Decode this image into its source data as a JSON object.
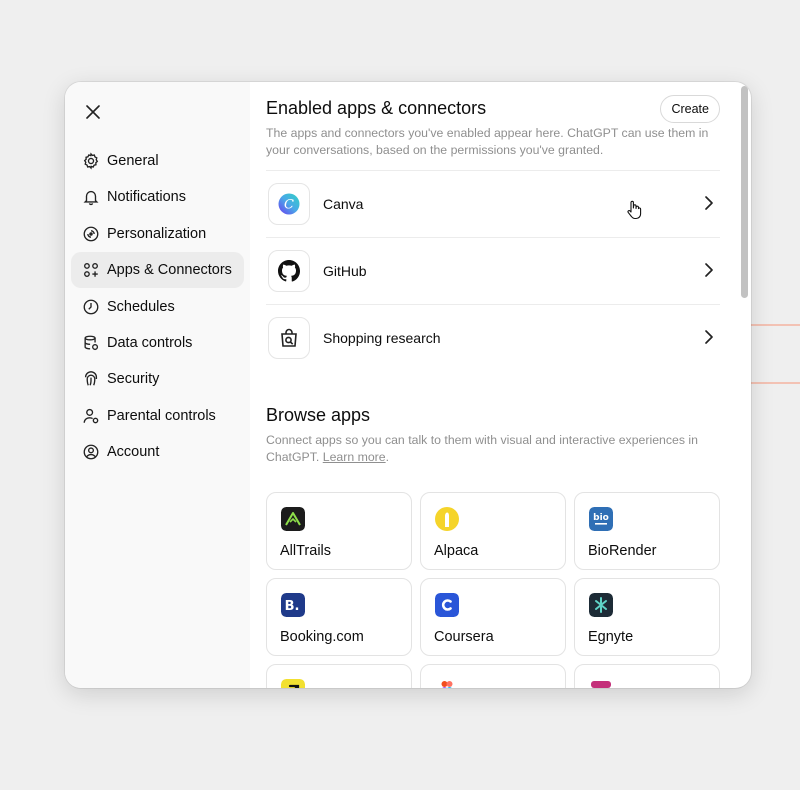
{
  "sidebar": {
    "items": [
      {
        "id": "general",
        "label": "General",
        "icon": "gear-icon"
      },
      {
        "id": "notifications",
        "label": "Notifications",
        "icon": "bell-icon"
      },
      {
        "id": "personalization",
        "label": "Personalization",
        "icon": "personalization-icon"
      },
      {
        "id": "apps",
        "label": "Apps & Connectors",
        "icon": "apps-grid-icon",
        "active": true
      },
      {
        "id": "schedules",
        "label": "Schedules",
        "icon": "clock-icon"
      },
      {
        "id": "data",
        "label": "Data controls",
        "icon": "database-icon"
      },
      {
        "id": "security",
        "label": "Security",
        "icon": "fingerprint-icon"
      },
      {
        "id": "parental",
        "label": "Parental controls",
        "icon": "parental-user-icon"
      },
      {
        "id": "account",
        "label": "Account",
        "icon": "user-circle-icon"
      }
    ]
  },
  "enabled": {
    "title": "Enabled apps & connectors",
    "create_label": "Create",
    "description": "The apps and connectors you've enabled appear here. ChatGPT can use them in your conversations, based on the permissions you've granted.",
    "apps": [
      {
        "name": "Canva",
        "icon": "canva-icon"
      },
      {
        "name": "GitHub",
        "icon": "github-icon"
      },
      {
        "name": "Shopping research",
        "icon": "shopping-bag-search-icon"
      }
    ]
  },
  "browse": {
    "title": "Browse apps",
    "description": "Connect apps so you can talk to them with visual and interactive experiences in ChatGPT.",
    "learn_more": "Learn more",
    "apps": [
      {
        "name": "AllTrails",
        "icon": "alltrails-icon",
        "color": "#1c1c1c"
      },
      {
        "name": "Alpaca",
        "icon": "alpaca-icon",
        "color": "#f5d42a"
      },
      {
        "name": "BioRender",
        "icon": "biorender-icon",
        "color": "#2f6fb5"
      },
      {
        "name": "Booking.com",
        "icon": "booking-icon",
        "color": "#1f3a8a"
      },
      {
        "name": "Coursera",
        "icon": "coursera-icon",
        "color": "#2a56d8"
      },
      {
        "name": "Egnyte",
        "icon": "egnyte-icon",
        "color": "#1d2b36"
      },
      {
        "name": "",
        "icon": "arrow-app-icon",
        "color": "#f2e030"
      },
      {
        "name": "",
        "icon": "figma-icon",
        "color": "#f24e1e"
      },
      {
        "name": "",
        "icon": "framer-like-icon",
        "color": "#c4307a"
      }
    ]
  },
  "colors": {
    "accent_active": "#ececec",
    "sidebar_bg": "#f9f9f9",
    "muted_text": "#8f8f8f"
  }
}
